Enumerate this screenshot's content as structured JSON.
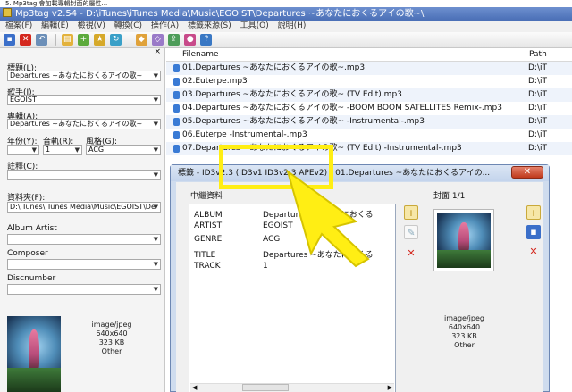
{
  "caption": "5. Mp3tag 會加載專輯封面的屬性...",
  "window": {
    "title": "Mp3tag v2.54 - D:\\iTunes\\iTunes Media\\Music\\EGOIST\\Departures ~あなたにおくるアイの歌~\\"
  },
  "menu": [
    "檔案(F)",
    "編輯(E)",
    "檢視(V)",
    "轉換(C)",
    "操作(A)",
    "標籤來源(S)",
    "工具(O)",
    "說明(H)"
  ],
  "toolbar": {
    "icons": [
      "save-icon",
      "delete-icon",
      "undo-icon",
      "folder-icon",
      "add-folder-icon",
      "star-icon",
      "refresh-icon",
      "tag-icon",
      "filename-icon",
      "export-icon",
      "web-icon",
      "help-icon"
    ]
  },
  "left_panel": {
    "fields": [
      {
        "label": "標題(L):",
        "value": "Departures ~あなたにおくるアイの歌~"
      },
      {
        "label": "歌手(I):",
        "value": "EGOIST"
      },
      {
        "label": "專輯(A):",
        "value": "Departures ~あなたにおくるアイの歌~"
      }
    ],
    "year_label": "年份(Y):",
    "track_label": "音軌(R):",
    "genre_label": "風格(G):",
    "track_value": "1",
    "genre_value": "ACG",
    "comment_label": "註釋(C):",
    "folder_label": "資料夾(F):",
    "folder_value": "D:\\iTunes\\iTunes Media\\Music\\EGOIST\\De",
    "album_artist_label": "Album Artist",
    "composer_label": "Composer",
    "discnumber_label": "Discnumber",
    "cover_meta": [
      "image/jpeg",
      "640x640",
      "323 KB",
      "Other"
    ]
  },
  "file_list": {
    "columns": [
      "Filename",
      "Path"
    ],
    "rows": [
      {
        "name": "01.Departures ~あなたにおくるアイの歌~.mp3",
        "path": "D:\\iT"
      },
      {
        "name": "02.Euterpe.mp3",
        "path": "D:\\iT"
      },
      {
        "name": "03.Departures ~あなたにおくるアイの歌~ (TV Edit).mp3",
        "path": "D:\\iT"
      },
      {
        "name": "04.Departures ~あなたにおくるアイの歌~ -BOOM BOOM SATELLITES Remix-.mp3",
        "path": "D:\\iT"
      },
      {
        "name": "05.Departures ~あなたにおくるアイの歌~ -Instrumental-.mp3",
        "path": "D:\\iT"
      },
      {
        "name": "06.Euterpe -Instrumental-.mp3",
        "path": "D:\\iT"
      },
      {
        "name": "07.Departures ~あなたにおくるアイの歌~ (TV Edit) -Instrumental-.mp3",
        "path": "D:\\iT"
      }
    ]
  },
  "dialog": {
    "title": "標籤 - ID3v2.3 (ID3v1 ID3v2.3 APEv2) - 01.Departures ~あなたにおくるアイの...",
    "close_label": "✕",
    "metadata_label": "中繼資料",
    "tags": [
      {
        "key": "ALBUM",
        "value": "Departures ~あなたにおくる"
      },
      {
        "key": "ARTIST",
        "value": "EGOIST"
      },
      {
        "key": "GENRE",
        "value": "ACG"
      },
      {
        "key": "TITLE",
        "value": "Departures ~あなたにおくる"
      },
      {
        "key": "TRACK",
        "value": "1"
      }
    ],
    "cover_label": "封面 1/1",
    "cover_meta": [
      "image/jpeg",
      "640x640",
      "323 KB",
      "Other"
    ]
  },
  "colors": {
    "callout": "#ffee14",
    "titlebar": "#4a6fb6",
    "delete_red": "#d4281e"
  }
}
